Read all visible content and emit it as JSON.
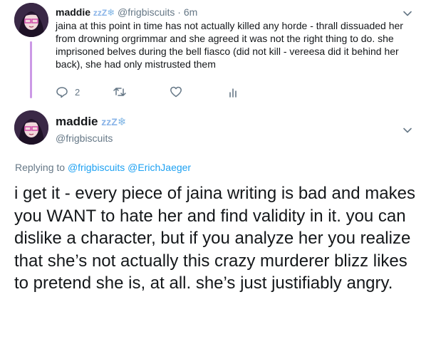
{
  "reply_tweet": {
    "name": "maddie",
    "zzz": "zzZ",
    "emoji": "❄",
    "handle": "@frigbiscuits",
    "separator": "·",
    "time": "6m",
    "text": "jaina at this point in time has not actually killed any horde - thrall dissuaded her from drowning orgrimmar and she agreed it was not the right thing to do. she imprisoned belves during the bell fiasco (did not kill - vereesa did it behind her back), she had only mistrusted them",
    "reply_count": "2",
    "icons": [
      "reply-icon",
      "retweet-icon",
      "like-icon",
      "analytics-icon",
      "chevron-down-icon"
    ]
  },
  "main_tweet": {
    "name": "maddie",
    "zzz": "zzZ",
    "emoji": "❄",
    "handle": "@frigbiscuits",
    "replying_to_label": "Replying to",
    "mention_1": "@frigbiscuits",
    "mention_2": "@ErichJaeger",
    "text": "i get it - every piece of jaina writing is bad and makes you WANT to hate her and find validity in it. you can dislike a character, but if you analyze her you realize that she’s not actually this crazy murderer blizz likes to pretend she is, at all. she’s just justifiably angry."
  },
  "colors": {
    "thread_line": "#cc99e6",
    "link": "#1da1f2",
    "muted": "#657786"
  }
}
